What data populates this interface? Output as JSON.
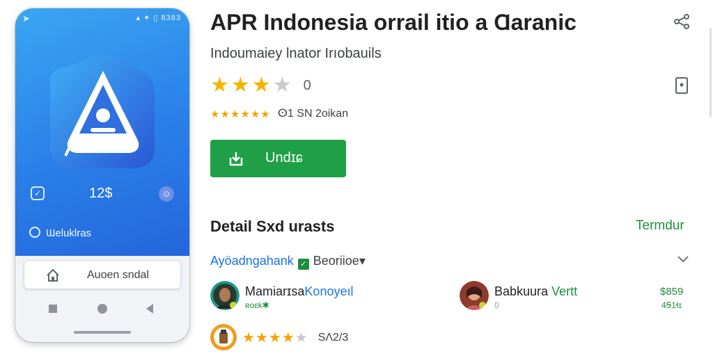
{
  "app": {
    "title": "APR Indonesia orrail itio a Ɑaranic",
    "subtitle": "Indoumaiey lnator Irıobauils",
    "rating": {
      "value_label": "0",
      "stars_filled": 3,
      "stars_total": 4
    },
    "rating_line": {
      "stars_filled": 6,
      "meta": "ⵙ1 SN 2oikan"
    },
    "install_label": "Undɪɕ",
    "icons": {
      "share": "share-icon",
      "bookmark": "bookmark-icon",
      "install": "install-icon"
    },
    "accent": "#20a046"
  },
  "phone": {
    "status": "▴ ✦ ▯ 8383",
    "count_label": "12$",
    "link_label": "Ɯeluklras",
    "button_label": "Auoen sndal",
    "screen_color": "#2a7fe8"
  },
  "details": {
    "section_title": "Detail Sxd urasts",
    "section_link": "Termdur",
    "filter_label": "Ayöadngahank",
    "filter_value": "Beoriioe▾"
  },
  "reviews": [
    {
      "name_a": "Mamiarɪsa",
      "name_b": "Konoyeıl",
      "sub": "ʀoɛk✱"
    },
    {
      "name_a": "Babkuura",
      "name_b": "Vertt",
      "sub": "0",
      "price_top": "$859",
      "price_bottom": "4Ꞩ1ɬɪ"
    },
    {
      "stars_filled": 4,
      "stars_total": 5,
      "value": "SΛ2/3"
    }
  ]
}
